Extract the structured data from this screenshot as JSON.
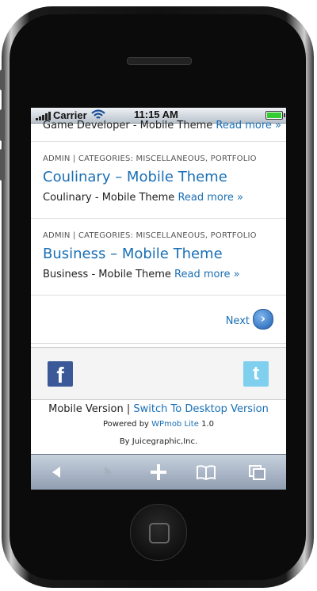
{
  "status_bar": {
    "carrier": "Carrier",
    "time": "11:15 AM"
  },
  "posts": [
    {
      "excerpt": "Game Developer - Mobile Theme",
      "more": "Read more »"
    },
    {
      "meta": "ADMIN | CATEGORIES: MISCELLANEOUS, PORTFOLIO",
      "title": "Coulinary – Mobile Theme",
      "excerpt": "Coulinary - Mobile Theme",
      "more": "Read more »"
    },
    {
      "meta": "ADMIN | CATEGORIES: MISCELLANEOUS, PORTFOLIO",
      "title": "Business – Mobile Theme",
      "excerpt": "Business - Mobile Theme",
      "more": "Read more »"
    }
  ],
  "pagination": {
    "next_label": "Next"
  },
  "social": {
    "facebook_letter": "f",
    "twitter_letter": "t"
  },
  "footer": {
    "mobile_version": "Mobile Version",
    "separator": "|",
    "switch_link": "Switch To Desktop Version",
    "powered_by": "Powered by",
    "wpmob_link": "WPmob Lite",
    "version": "1.0",
    "credit": "By Juicegraphic,Inc."
  },
  "toolbar": {
    "icons": [
      "back-arrow-icon",
      "forward-arrow-icon",
      "plus-icon",
      "bookmarks-icon",
      "pages-icon"
    ]
  },
  "colors": {
    "link": "#1a6fb5",
    "facebook": "#3b5998",
    "twitter": "#7fd0ef"
  }
}
